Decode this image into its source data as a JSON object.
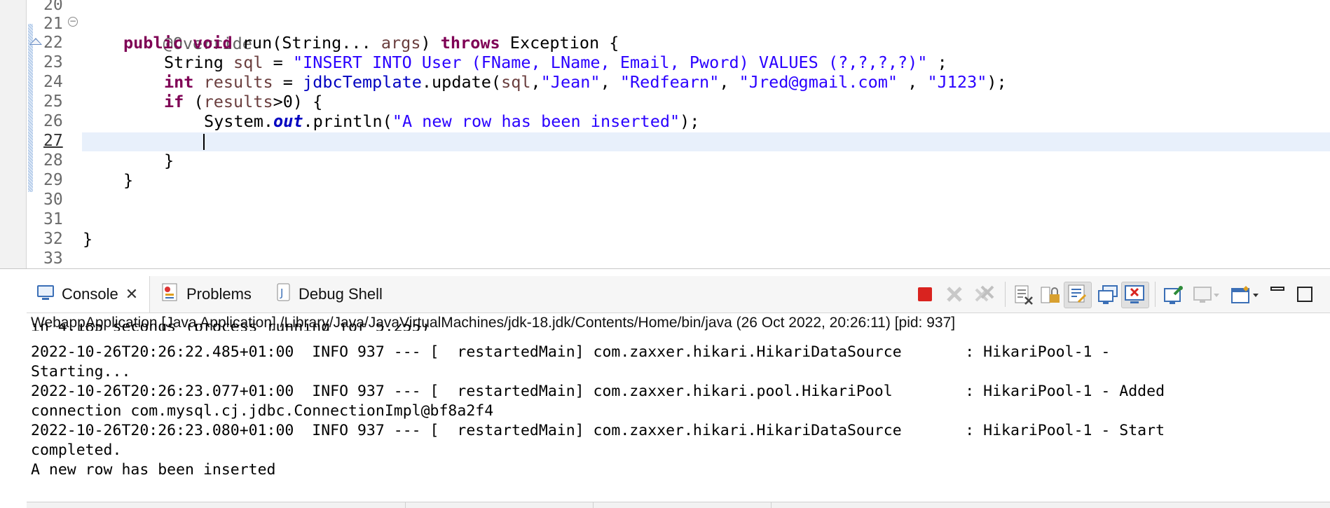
{
  "editor": {
    "line_numbers": [
      "20",
      "21",
      "22",
      "23",
      "24",
      "25",
      "26",
      "27",
      "28",
      "29",
      "30",
      "31",
      "32",
      "33"
    ],
    "current_line": "27",
    "lines": {
      "l21": {
        "annotation": "@Override"
      },
      "l22": {
        "kw_public": "public",
        "kw_void": "void",
        "method": " run(String... ",
        "param": "args",
        "paren": ") ",
        "kw_throws": "throws",
        "rest": " Exception {"
      },
      "l23": {
        "type": "String ",
        "var": "sql",
        "eq": " = ",
        "str": "\"INSERT INTO User (FName, LName, Email, Pword) VALUES (?,?,?,?)\"",
        "end": " ;"
      },
      "l24": {
        "kw_int": "int",
        "sp": " ",
        "var": "results",
        "eq": " = ",
        "field": "jdbcTemplate",
        "call": ".update(",
        "arg": "sql",
        "comma": ",",
        "s1": "\"Jean\"",
        "c1": ", ",
        "s2": "\"Redfearn\"",
        "c2": ", ",
        "s3": "\"Jred@gmail.com\"",
        "c3": " , ",
        "s4": "\"J123\"",
        "end": ");"
      },
      "l25": {
        "kw_if": "if",
        "open": " (",
        "var": "results",
        "cond": ">0) {"
      },
      "l26": {
        "cls": "System.",
        "field": "out",
        "call": ".println(",
        "str": "\"A new row has been inserted\"",
        "end": ");"
      },
      "l28": {
        "text": "}"
      },
      "l29": {
        "text": "}"
      },
      "l32": {
        "text": "}"
      }
    }
  },
  "console": {
    "tabs": [
      {
        "label": "Console",
        "icon": "console-icon",
        "active": true
      },
      {
        "label": "Problems",
        "icon": "problems-icon"
      },
      {
        "label": "Debug Shell",
        "icon": "debug-shell-icon"
      }
    ],
    "toolbar_icons": [
      "terminate-icon",
      "remove-launch-icon",
      "remove-all-terminated-icon",
      "clear-console-icon",
      "scroll-lock-icon",
      "word-wrap-icon",
      "show-on-stdout-icon",
      "show-on-stderr-icon",
      "pin-console-icon",
      "display-selected-console-icon",
      "open-console-icon",
      "minimize-icon",
      "maximize-icon"
    ],
    "process_description": "WebappApplication [Java Application] /Library/Java/JavaVirtualMachines/jdk-18.jdk/Contents/Home/bin/java  (26 Oct 2022, 20:26:11) [pid: 937]",
    "output_lines": [
      "in 4.185 seconds (process running for 5.255)",
      "2022-10-26T20:26:22.485+01:00  INFO 937 --- [  restartedMain] com.zaxxer.hikari.HikariDataSource       : HikariPool-1 -",
      "Starting...",
      "2022-10-26T20:26:23.077+01:00  INFO 937 --- [  restartedMain] com.zaxxer.hikari.pool.HikariPool        : HikariPool-1 - Added",
      "connection com.mysql.cj.jdbc.ConnectionImpl@bf8a2f4",
      "2022-10-26T20:26:23.080+01:00  INFO 937 --- [  restartedMain] com.zaxxer.hikari.HikariDataSource       : HikariPool-1 - Start",
      "completed.",
      "A new row has been inserted"
    ]
  },
  "colors": {
    "keyword": "#7f0055",
    "string": "#2a00ff",
    "field": "#0000c0",
    "local_var": "#6a3e3e",
    "annotation": "#646464",
    "current_line_bg": "#e8f0fb",
    "terminate_red": "#d9231f"
  }
}
